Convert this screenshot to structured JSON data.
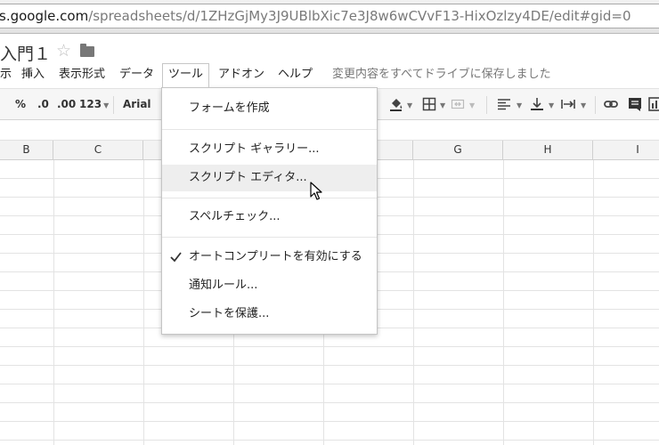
{
  "browser": {
    "url_host": "s.google.com",
    "url_path": "/spreadsheets/d/1ZHzGjMy3J9UBlbXic7e3J8w6wCVvF13-HixOzlzy4DE/edit#gid=0"
  },
  "doc": {
    "title": "入門１"
  },
  "menubar": {
    "items": [
      "示",
      "挿入",
      "表示形式",
      "データ",
      "ツール",
      "アドオン",
      "ヘルプ"
    ],
    "save_status": "変更内容をすべてドライブに保存しました"
  },
  "toolbar": {
    "percent": "%",
    "decimal_decrease": ".0",
    "decimal_increase": ".00",
    "number_format": "123",
    "font": "Arial"
  },
  "columns": [
    "B",
    "C",
    "",
    "",
    "",
    "G",
    "H",
    "I"
  ],
  "tools_menu": {
    "items": [
      {
        "label": "フォームを作成",
        "checked": false
      },
      {
        "label": "スクリプト ギャラリー...",
        "checked": false
      },
      {
        "label": "スクリプト エディタ...",
        "checked": false,
        "hovered": true
      },
      {
        "label": "スペルチェック...",
        "checked": false
      },
      {
        "label": "オートコンプリートを有効にする",
        "checked": true
      },
      {
        "label": "通知ルール...",
        "checked": false
      },
      {
        "label": "シートを保護...",
        "checked": false
      }
    ]
  },
  "colors": {
    "menu_hover": "#eeeeee",
    "toolbar_bg": "#f6f6f6",
    "header_bg": "#f3f3f3"
  }
}
